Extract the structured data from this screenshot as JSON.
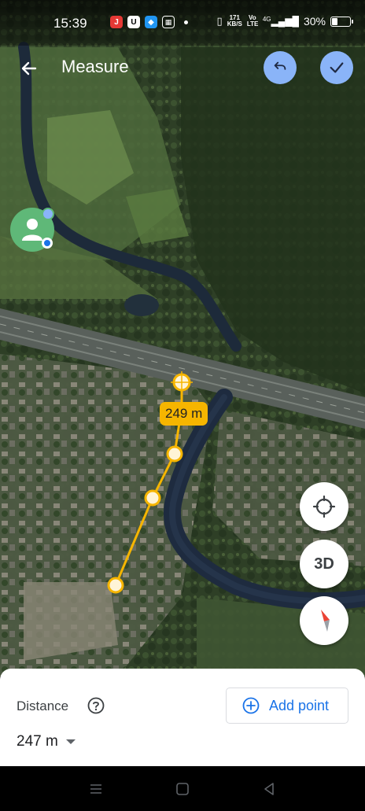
{
  "status_bar": {
    "time": "15:39",
    "notifications": [
      "jio-icon",
      "u-icon",
      "messenger-icon",
      "calculator-icon"
    ],
    "net_speed": "171",
    "net_unit": "KB/S",
    "volte": "Vo LTE",
    "network": "4G",
    "battery": "30%",
    "battery_level": 0.3
  },
  "app_bar": {
    "title": "Measure"
  },
  "map": {
    "measure_label": "249 m",
    "line_color": "#f6b500"
  },
  "map_controls": {
    "three_d_label": "3D"
  },
  "bottom_sheet": {
    "distance_label": "Distance",
    "add_point_label": "Add point",
    "distance_value": "247 m"
  },
  "colors": {
    "accent": "#1a73e8",
    "action_buttons": "#8ab4f8",
    "measure": "#f6b500"
  }
}
